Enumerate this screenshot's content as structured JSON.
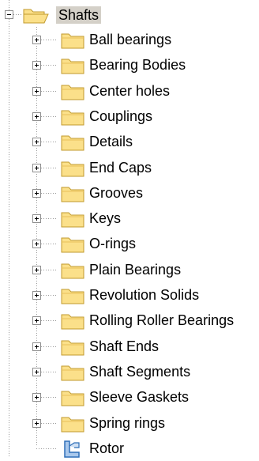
{
  "tree": {
    "root": {
      "label": "Shafts",
      "expanded": true,
      "icon": "folder-open-icon",
      "selected": true
    },
    "children": [
      {
        "label": "Ball bearings",
        "icon": "folder-icon",
        "expandable": true
      },
      {
        "label": "Bearing Bodies",
        "icon": "folder-icon",
        "expandable": true
      },
      {
        "label": "Center holes",
        "icon": "folder-icon",
        "expandable": true
      },
      {
        "label": "Couplings",
        "icon": "folder-icon",
        "expandable": true
      },
      {
        "label": "Details",
        "icon": "folder-icon",
        "expandable": true
      },
      {
        "label": "End Caps",
        "icon": "folder-icon",
        "expandable": true
      },
      {
        "label": "Grooves",
        "icon": "folder-icon",
        "expandable": true
      },
      {
        "label": "Keys",
        "icon": "folder-icon",
        "expandable": true
      },
      {
        "label": "O-rings",
        "icon": "folder-icon",
        "expandable": true
      },
      {
        "label": "Plain Bearings",
        "icon": "folder-icon",
        "expandable": true
      },
      {
        "label": "Revolution Solids",
        "icon": "folder-icon",
        "expandable": true
      },
      {
        "label": "Rolling Roller Bearings",
        "icon": "folder-icon",
        "expandable": true
      },
      {
        "label": "Shaft Ends",
        "icon": "folder-icon",
        "expandable": true
      },
      {
        "label": "Shaft Segments",
        "icon": "folder-icon",
        "expandable": true
      },
      {
        "label": "Sleeve Gaskets",
        "icon": "folder-icon",
        "expandable": true
      },
      {
        "label": "Spring rings",
        "icon": "folder-icon",
        "expandable": true
      },
      {
        "label": "Rotor",
        "icon": "part-icon",
        "expandable": false
      }
    ],
    "colors": {
      "folder_fill": "#fbe08a",
      "folder_stroke": "#c19a2e",
      "selection": "#d4d0c8",
      "connector": "#9a9a9a",
      "part_icon": "#2f6fb8"
    }
  }
}
